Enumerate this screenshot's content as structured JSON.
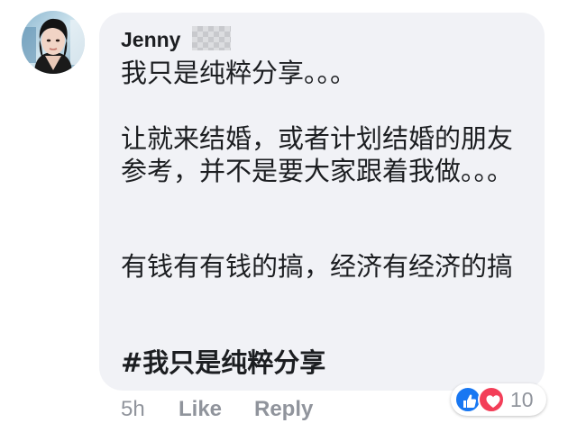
{
  "comment": {
    "author_name": "Jenny",
    "lines": {
      "p1": "我只是纯粹分享。。。",
      "p2": "让就来结婚，或者计划结婚的朋友参考，并不是要大家跟着我做。。。",
      "p3": "有钱有有钱的搞，经济有经济的搞",
      "hashtag": "#我只是纯粹分享"
    }
  },
  "actions": {
    "timestamp": "5h",
    "like_label": "Like",
    "reply_label": "Reply"
  },
  "reactions": {
    "icons": [
      "like-icon",
      "love-icon"
    ],
    "count": "10"
  },
  "colors": {
    "bubble": "#f1f2f6",
    "like_blue": "#1877f2",
    "love_red": "#f33e58",
    "meta_gray": "#90949c"
  }
}
